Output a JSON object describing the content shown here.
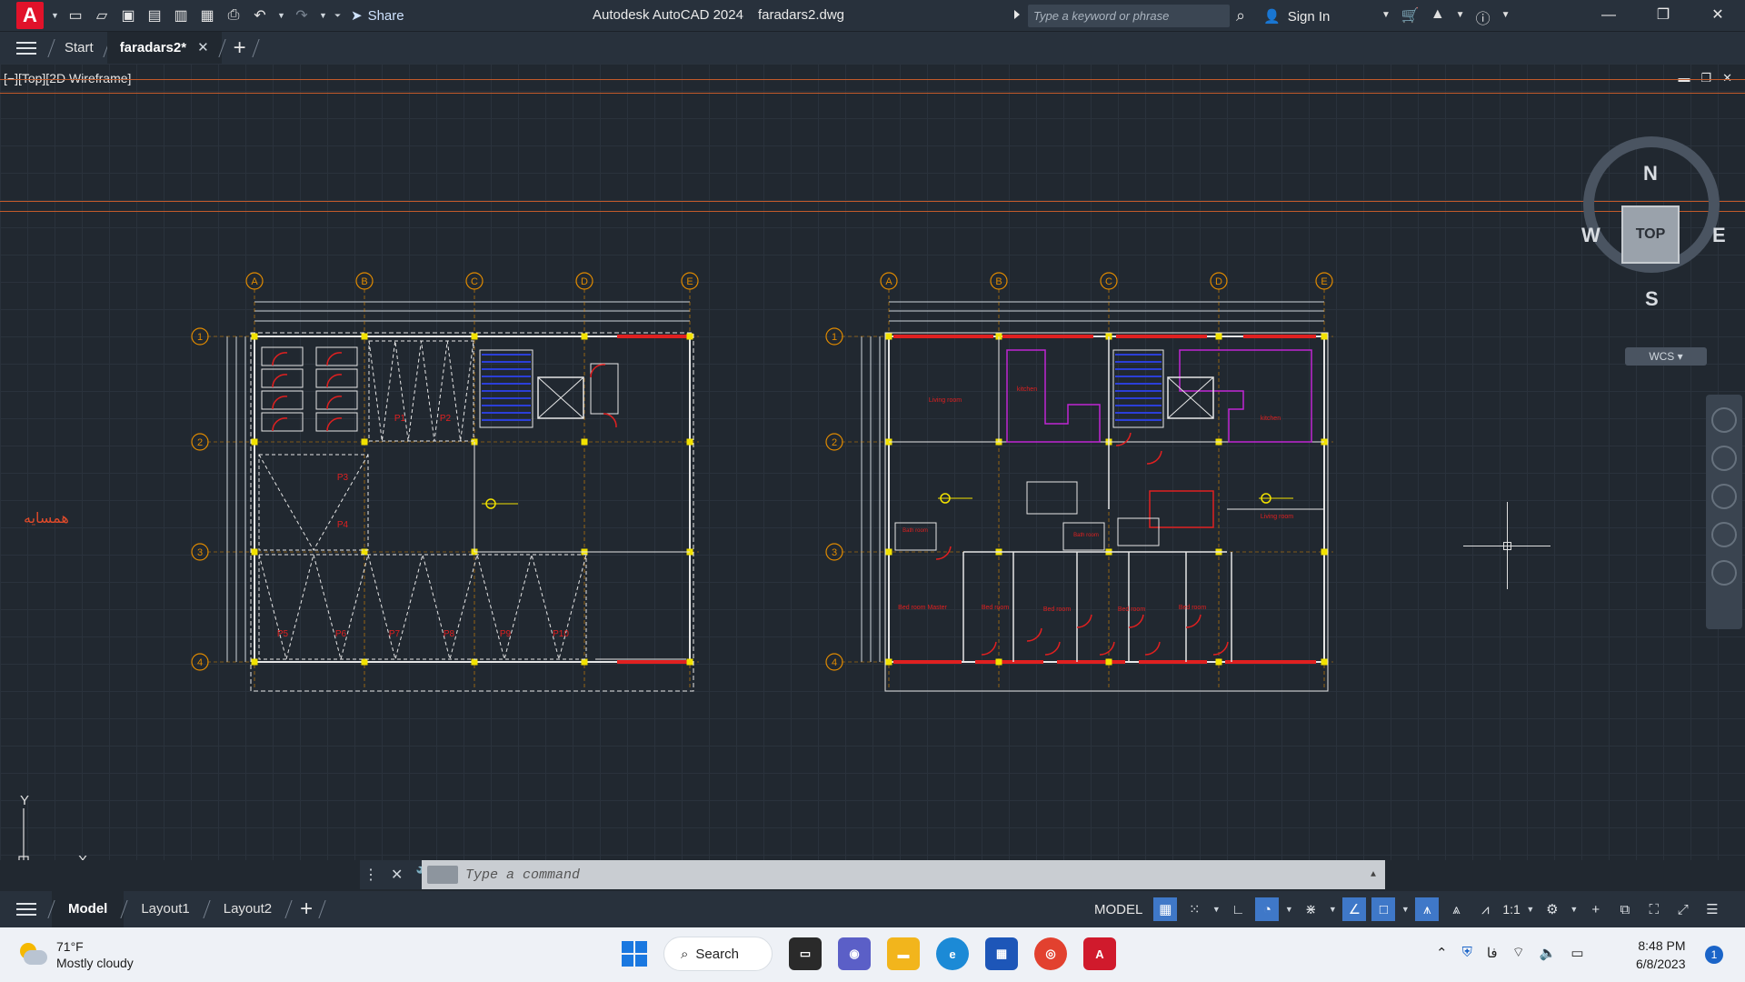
{
  "titlebar": {
    "app_letter": "A",
    "share_label": "Share",
    "app_title": "Autodesk AutoCAD 2024",
    "file_title": "faradars2.dwg",
    "search_placeholder": "Type a keyword or phrase",
    "signin_label": "Sign In"
  },
  "tabs": {
    "start_label": "Start",
    "file_tab_label": "faradars2*"
  },
  "viewport": {
    "label": "[−][Top][2D Wireframe]",
    "neighbor_label": "همسایه",
    "grid_columns": [
      "A",
      "B",
      "C",
      "D",
      "E"
    ],
    "grid_rows": [
      "1",
      "2",
      "3",
      "4"
    ],
    "parking_labels": [
      "P1",
      "P2",
      "P3",
      "P4",
      "P5",
      "P6",
      "P7",
      "P8",
      "P9",
      "P10"
    ],
    "room_labels": {
      "living_left": "Living room",
      "kitchen_left": "kitchen",
      "kitchen_right": "kitchen",
      "living_right": "Living room",
      "bath_left": "Bath room",
      "bath_mid": "Bath room",
      "bedroom_master": "Bed room Master",
      "bedroom_1": "Bed room",
      "bedroom_2": "Bed room",
      "bedroom_3": "Bed room",
      "bedroom_4": "Bed room"
    }
  },
  "viewcube": {
    "north": "N",
    "south": "S",
    "east": "E",
    "west": "W",
    "top_face": "TOP",
    "wcs_label": "WCS"
  },
  "ucs": {
    "x_label": "X",
    "y_label": "Y"
  },
  "command": {
    "placeholder": "Type a command"
  },
  "status": {
    "model_tab": "Model",
    "layout1": "Layout1",
    "layout2": "Layout2",
    "space_label": "MODEL",
    "scale_label": "1:1"
  },
  "taskbar": {
    "temperature": "71°F",
    "weather": "Mostly cloudy",
    "search_label": "Search",
    "language": "فا",
    "time": "8:48 PM",
    "date": "6/8/2023",
    "notification_count": "1"
  },
  "colors": {
    "accent_red": "#e1122a",
    "grid_orange": "#e08a00",
    "wall_white": "#e6e6e6",
    "door_red": "#e02020",
    "stair_blue": "#2b3fd8",
    "kitchen_magenta": "#c026d3"
  }
}
